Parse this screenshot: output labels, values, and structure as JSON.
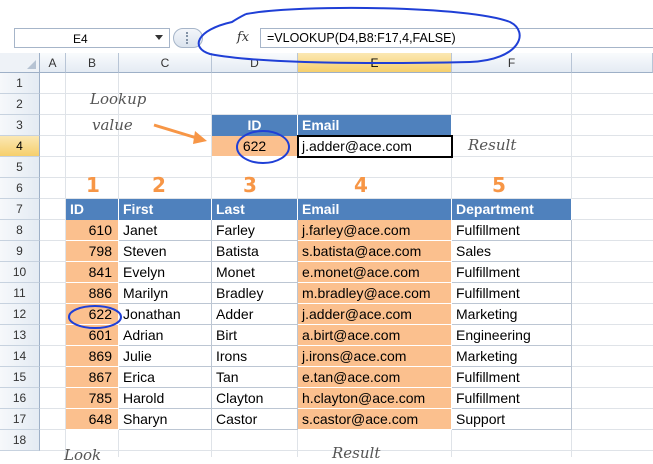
{
  "formula_bar": {
    "name_box": "E4",
    "fx_label": "fx",
    "formula": "=VLOOKUP(D4,B8:F17,4,FALSE)"
  },
  "columns": [
    "A",
    "B",
    "C",
    "D",
    "E",
    "F"
  ],
  "rows": [
    "1",
    "2",
    "3",
    "4",
    "5",
    "6",
    "7",
    "8",
    "9",
    "10",
    "11",
    "12",
    "13",
    "14",
    "15",
    "16",
    "17",
    "18"
  ],
  "lookup": {
    "header_id": "ID",
    "header_email": "Email",
    "id_value": "622",
    "email_value": "j.adder@ace.com"
  },
  "annotations": {
    "lookup_value_line1": "Lookup",
    "lookup_value_line2": "value",
    "result": "Result",
    "bottom_left": "Look",
    "bottom_result": "Result"
  },
  "column_numbers": [
    "1",
    "2",
    "3",
    "4",
    "5"
  ],
  "table": {
    "headers": [
      "ID",
      "First",
      "Last",
      "Email",
      "Department"
    ],
    "rows": [
      [
        "610",
        "Janet",
        "Farley",
        "j.farley@ace.com",
        "Fulfillment"
      ],
      [
        "798",
        "Steven",
        "Batista",
        "s.batista@ace.com",
        "Sales"
      ],
      [
        "841",
        "Evelyn",
        "Monet",
        "e.monet@ace.com",
        "Fulfillment"
      ],
      [
        "886",
        "Marilyn",
        "Bradley",
        "m.bradley@ace.com",
        "Fulfillment"
      ],
      [
        "622",
        "Jonathan",
        "Adder",
        "j.adder@ace.com",
        "Marketing"
      ],
      [
        "601",
        "Adrian",
        "Birt",
        "a.birt@ace.com",
        "Engineering"
      ],
      [
        "869",
        "Julie",
        "Irons",
        "j.irons@ace.com",
        "Marketing"
      ],
      [
        "867",
        "Erica",
        "Tan",
        "e.tan@ace.com",
        "Fulfillment"
      ],
      [
        "785",
        "Harold",
        "Clayton",
        "h.clayton@ace.com",
        "Fulfillment"
      ],
      [
        "648",
        "Sharyn",
        "Castor",
        "s.castor@ace.com",
        "Support"
      ]
    ]
  },
  "colors": {
    "header_blue": "#4f81bd",
    "highlight_orange": "#fbc08e",
    "annotation_orange": "#f79646",
    "ink_blue": "#1f3fd6"
  }
}
